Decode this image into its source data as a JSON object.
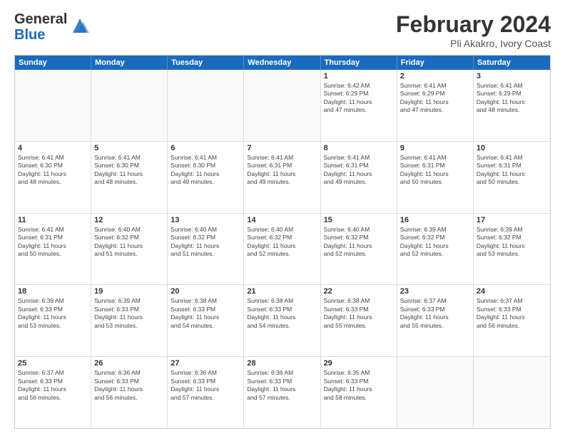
{
  "logo": {
    "line1": "General",
    "line2": "Blue"
  },
  "title": "February 2024",
  "subtitle": "Pli Akakro, Ivory Coast",
  "days": [
    "Sunday",
    "Monday",
    "Tuesday",
    "Wednesday",
    "Thursday",
    "Friday",
    "Saturday"
  ],
  "weeks": [
    [
      {
        "num": "",
        "info": ""
      },
      {
        "num": "",
        "info": ""
      },
      {
        "num": "",
        "info": ""
      },
      {
        "num": "",
        "info": ""
      },
      {
        "num": "1",
        "info": "Sunrise: 6:42 AM\nSunset: 6:29 PM\nDaylight: 11 hours\nand 47 minutes."
      },
      {
        "num": "2",
        "info": "Sunrise: 6:41 AM\nSunset: 6:29 PM\nDaylight: 11 hours\nand 47 minutes."
      },
      {
        "num": "3",
        "info": "Sunrise: 6:41 AM\nSunset: 6:29 PM\nDaylight: 11 hours\nand 48 minutes."
      }
    ],
    [
      {
        "num": "4",
        "info": "Sunrise: 6:41 AM\nSunset: 6:30 PM\nDaylight: 11 hours\nand 48 minutes."
      },
      {
        "num": "5",
        "info": "Sunrise: 6:41 AM\nSunset: 6:30 PM\nDaylight: 11 hours\nand 48 minutes."
      },
      {
        "num": "6",
        "info": "Sunrise: 6:41 AM\nSunset: 6:30 PM\nDaylight: 11 hours\nand 49 minutes."
      },
      {
        "num": "7",
        "info": "Sunrise: 6:41 AM\nSunset: 6:31 PM\nDaylight: 11 hours\nand 49 minutes."
      },
      {
        "num": "8",
        "info": "Sunrise: 6:41 AM\nSunset: 6:31 PM\nDaylight: 11 hours\nand 49 minutes."
      },
      {
        "num": "9",
        "info": "Sunrise: 6:41 AM\nSunset: 6:31 PM\nDaylight: 11 hours\nand 50 minutes."
      },
      {
        "num": "10",
        "info": "Sunrise: 6:41 AM\nSunset: 6:31 PM\nDaylight: 11 hours\nand 50 minutes."
      }
    ],
    [
      {
        "num": "11",
        "info": "Sunrise: 6:41 AM\nSunset: 6:31 PM\nDaylight: 11 hours\nand 50 minutes."
      },
      {
        "num": "12",
        "info": "Sunrise: 6:40 AM\nSunset: 6:32 PM\nDaylight: 11 hours\nand 51 minutes."
      },
      {
        "num": "13",
        "info": "Sunrise: 6:40 AM\nSunset: 6:32 PM\nDaylight: 11 hours\nand 51 minutes."
      },
      {
        "num": "14",
        "info": "Sunrise: 6:40 AM\nSunset: 6:32 PM\nDaylight: 11 hours\nand 52 minutes."
      },
      {
        "num": "15",
        "info": "Sunrise: 6:40 AM\nSunset: 6:32 PM\nDaylight: 11 hours\nand 52 minutes."
      },
      {
        "num": "16",
        "info": "Sunrise: 6:39 AM\nSunset: 6:32 PM\nDaylight: 11 hours\nand 52 minutes."
      },
      {
        "num": "17",
        "info": "Sunrise: 6:39 AM\nSunset: 6:32 PM\nDaylight: 11 hours\nand 53 minutes."
      }
    ],
    [
      {
        "num": "18",
        "info": "Sunrise: 6:39 AM\nSunset: 6:33 PM\nDaylight: 11 hours\nand 53 minutes."
      },
      {
        "num": "19",
        "info": "Sunrise: 6:39 AM\nSunset: 6:33 PM\nDaylight: 11 hours\nand 53 minutes."
      },
      {
        "num": "20",
        "info": "Sunrise: 6:38 AM\nSunset: 6:33 PM\nDaylight: 11 hours\nand 54 minutes."
      },
      {
        "num": "21",
        "info": "Sunrise: 6:38 AM\nSunset: 6:33 PM\nDaylight: 11 hours\nand 54 minutes."
      },
      {
        "num": "22",
        "info": "Sunrise: 6:38 AM\nSunset: 6:33 PM\nDaylight: 11 hours\nand 55 minutes."
      },
      {
        "num": "23",
        "info": "Sunrise: 6:37 AM\nSunset: 6:33 PM\nDaylight: 11 hours\nand 55 minutes."
      },
      {
        "num": "24",
        "info": "Sunrise: 6:37 AM\nSunset: 6:33 PM\nDaylight: 11 hours\nand 56 minutes."
      }
    ],
    [
      {
        "num": "25",
        "info": "Sunrise: 6:37 AM\nSunset: 6:33 PM\nDaylight: 11 hours\nand 56 minutes."
      },
      {
        "num": "26",
        "info": "Sunrise: 6:36 AM\nSunset: 6:33 PM\nDaylight: 11 hours\nand 56 minutes."
      },
      {
        "num": "27",
        "info": "Sunrise: 6:36 AM\nSunset: 6:33 PM\nDaylight: 11 hours\nand 57 minutes."
      },
      {
        "num": "28",
        "info": "Sunrise: 6:36 AM\nSunset: 6:33 PM\nDaylight: 11 hours\nand 57 minutes."
      },
      {
        "num": "29",
        "info": "Sunrise: 6:35 AM\nSunset: 6:33 PM\nDaylight: 11 hours\nand 58 minutes."
      },
      {
        "num": "",
        "info": ""
      },
      {
        "num": "",
        "info": ""
      }
    ]
  ]
}
